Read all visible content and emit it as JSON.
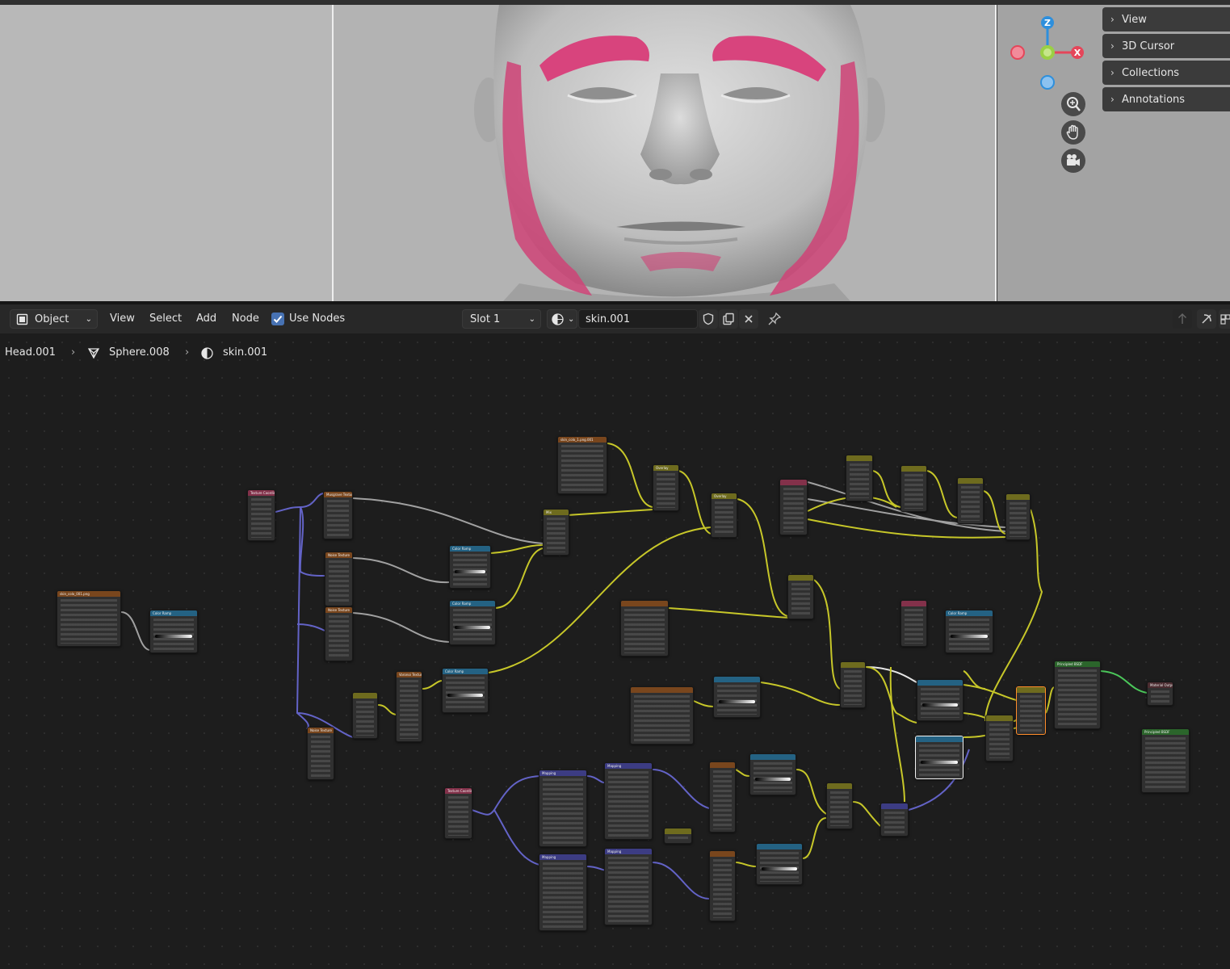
{
  "viewport": {
    "n_panel_tabs": [
      {
        "label": "View"
      },
      {
        "label": "3D Cursor"
      },
      {
        "label": "Collections"
      },
      {
        "label": "Annotations"
      }
    ],
    "gizmo": {
      "z_label": "Z",
      "x_label": "X"
    },
    "nav_icons": [
      "zoom-icon",
      "pan-hand-icon",
      "camera-icon"
    ]
  },
  "node_header": {
    "mode_label": "Object",
    "menus": [
      "View",
      "Select",
      "Add",
      "Node"
    ],
    "use_nodes_label": "Use Nodes",
    "use_nodes_checked": true,
    "slot_label": "Slot 1",
    "material_name": "skin.001"
  },
  "breadcrumb": {
    "object": "Head.001",
    "mesh": "Sphere.008",
    "material": "skin.001"
  },
  "node_titles": {
    "n1": "Texture Coordinate",
    "n2": "Musgrave Texture",
    "n3": "Noise Texture",
    "n4": "Noise Texture",
    "n5": "Color Ramp",
    "n6": "Color Ramp",
    "n7": "skin_colo_1.png.001",
    "n8": "Mix",
    "n9": "Overlay",
    "n10": "Overlay",
    "n11": "Color Ramp",
    "n12": "Voronoi Texture",
    "n13": "Noise Texture",
    "n14": "Color Ramp",
    "n15": "skin_colo_001.png",
    "n16": "Color Ramp",
    "n17": "Mapping",
    "n18": "Mapping",
    "n19": "Mapping",
    "n20": "Mapping",
    "n21": "Texture Coordinate",
    "n22": "Principled BSDF",
    "n23": "Material Output",
    "n24": "Principled BSDF"
  },
  "colors": {
    "header_input": "#83314a",
    "header_texture": "#79461d",
    "header_converter": "#246283",
    "header_color": "#6e6b1e",
    "header_vector": "#3c3c83",
    "header_shader": "#2b652b",
    "header_output": "#4b2c30",
    "wire_yellow": "#c7c729",
    "wire_gray": "#a1a1a1",
    "wire_purple": "#6363c7",
    "wire_green": "#4bc75a",
    "hair_pink": "#d44a7d"
  }
}
